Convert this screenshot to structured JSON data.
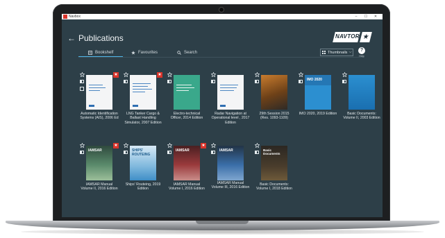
{
  "window": {
    "app_name": "Navbox",
    "minimize": "–",
    "maximize": "☐",
    "close": "✕"
  },
  "header": {
    "back": "←",
    "title": "Publications",
    "logo_text": "NAVTOR",
    "logo_mark": "★"
  },
  "tabs": [
    {
      "label": "Bookshelf",
      "icon": "book-icon",
      "active": true
    },
    {
      "label": "Favourites",
      "icon": "star-icon",
      "active": false
    },
    {
      "label": "Search",
      "icon": "search-icon",
      "active": false
    }
  ],
  "view_select": {
    "value": "Thumbnails",
    "arrow": "⌵"
  },
  "help": {
    "symbol": "?",
    "label": "Help"
  },
  "colors": {
    "background": "#2d3f48",
    "accent": "#4fb4e6",
    "badge": "#d9342b"
  },
  "books": [
    {
      "caption": "Automatic Identification Systems (AIS), 2006 Ed",
      "favourite": false,
      "badge": "★",
      "cover": "white"
    },
    {
      "caption": "LNG Tanker Cargo & Ballast Handling Simulator, 2007 Edition",
      "favourite": false,
      "badge": "★",
      "cover": "white"
    },
    {
      "caption": "Electro-technical Officer, 2014 Edition",
      "favourite": false,
      "badge": "",
      "cover": "green"
    },
    {
      "caption": "Radar Navigation at Operational level , 2017 Edition",
      "favourite": false,
      "badge": "",
      "cover": "white"
    },
    {
      "caption": "29th Session 2015 (Res. 1093-1109)",
      "favourite": false,
      "badge": "",
      "cover": "rust"
    },
    {
      "caption": "IMO 2020, 2019 Edition",
      "favourite": false,
      "badge": "",
      "cover": "imo",
      "cover_label": "IMO 2020"
    },
    {
      "caption": "Basic Documents: Volume II, 2003 Edition",
      "favourite": false,
      "badge": "",
      "cover": "blue"
    },
    {
      "caption": "IAMSAR Manual Volume II, 2016 Edition",
      "favourite": false,
      "badge": "★",
      "cover": "iamsar",
      "cover_label": "IAMSAR"
    },
    {
      "caption": "Ships' Routeing, 2019 Edition",
      "favourite": false,
      "badge": "",
      "cover": "routeing",
      "cover_label": "SHIPS' ROUTEING"
    },
    {
      "caption": "IAMSAR Manual Volume I, 2016 Edition",
      "favourite": false,
      "badge": "★",
      "cover": "iamsar1",
      "cover_label": "IAMSAR"
    },
    {
      "caption": "IAMSAR Manual Volume III, 2016 Edition",
      "favourite": false,
      "badge": "",
      "cover": "iamsar3",
      "cover_label": "IAMSAR"
    },
    {
      "caption": "Basic Documents: Volume I, 2018 Edition",
      "favourite": false,
      "badge": "",
      "cover": "dark",
      "cover_label": "Basic Documents"
    }
  ]
}
